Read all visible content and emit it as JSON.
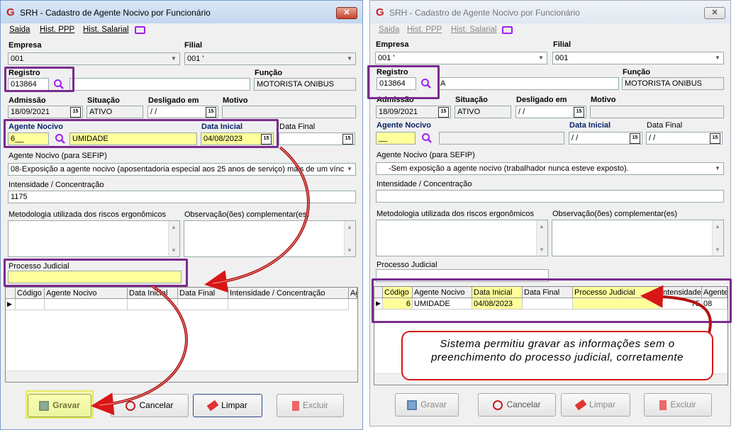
{
  "left": {
    "title": "SRH - Cadastro de Agente Nocivo por Funcionário",
    "close": "✕",
    "menu": {
      "saida": "Saida",
      "ppp": "Hist. PPP",
      "salarial": "Hist. Salarial"
    },
    "empresa": {
      "label": "Empresa",
      "value": "001"
    },
    "filial": {
      "label": "Filial",
      "value": "001 '"
    },
    "registro": {
      "label": "Registro",
      "value": "013864",
      "name": ""
    },
    "funcao": {
      "label": "Função",
      "value": "MOTORISTA ONIBUS"
    },
    "admissao": {
      "label": "Admissão",
      "value": "18/09/2021"
    },
    "situacao": {
      "label": "Situação",
      "value": "ATIVO"
    },
    "desligado": {
      "label": "Desligado em",
      "value": " / /"
    },
    "motivo": {
      "label": "Motivo",
      "value": ""
    },
    "agente": {
      "label": "Agente Nocivo",
      "code": "6__",
      "name": "UMIDADE"
    },
    "data_inicial": {
      "label": "Data Inicial",
      "value": "04/08/2023"
    },
    "data_final": {
      "label": "Data Final",
      "value": ""
    },
    "sefip": {
      "label": "Agente Nocivo (para SEFIP)",
      "value": "08-Exposição a agente nocivo (aposentadoria especial aos 25 anos de serviço) mais de um vínculo"
    },
    "intensidade": {
      "label": "Intensidade /  Concentração",
      "value": "1175"
    },
    "metodologia": {
      "label": "Metodologia utilizada dos riscos ergonômicos"
    },
    "observacao": {
      "label": "Observação(ões) complementar(es)"
    },
    "processo": {
      "label": "Processo Judicial",
      "value": ""
    },
    "grid": {
      "headers": [
        "Código",
        "Agente Nocivo",
        "Data Inicial",
        "Data Final",
        "Intensidade /  Concentração",
        "Ag"
      ]
    },
    "buttons": {
      "gravar": "Gravar",
      "cancelar": "Cancelar",
      "limpar": "Limpar",
      "excluir": "Excluir"
    }
  },
  "right": {
    "title": "SRH - Cadastro de Agente Nocivo por Funcionário",
    "close": "✕",
    "menu": {
      "saida": "Saida",
      "ppp": "Hist. PPP",
      "salarial": "Hist. Salarial"
    },
    "empresa": {
      "label": "Empresa",
      "value": "001 '"
    },
    "filial": {
      "label": "Filial",
      "value": "001"
    },
    "registro": {
      "label": "Registro",
      "value": "013864",
      "name": "A"
    },
    "funcao": {
      "label": "Função",
      "value": "MOTORISTA ONIBUS"
    },
    "admissao": {
      "label": "Admissão",
      "value": "18/09/2021"
    },
    "situacao": {
      "label": "Situação",
      "value": "ATIVO"
    },
    "desligado": {
      "label": "Desligado em",
      "value": " / /"
    },
    "motivo": {
      "label": "Motivo",
      "value": ""
    },
    "agente": {
      "label": "Agente Nocivo",
      "code": "__",
      "name": ""
    },
    "data_inicial": {
      "label": "Data Inicial",
      "value": " / /"
    },
    "data_final": {
      "label": "Data Final",
      "value": " / /"
    },
    "sefip": {
      "label": "Agente Nocivo (para SEFIP)",
      "value": "-Sem exposição a agente nocivo (trabalhador nunca esteve exposto)."
    },
    "intensidade": {
      "label": "Intensidade /  Concentração",
      "value": ""
    },
    "metodologia": {
      "label": "Metodologia utilizada dos riscos ergonômicos"
    },
    "observacao": {
      "label": "Observação(ões) complementar(es)"
    },
    "processo": {
      "label": "Processo Judicial",
      "value": ""
    },
    "grid": {
      "headers": [
        "Código",
        "Agente Nocivo",
        "Data Inicial",
        "Data Final",
        "Processo Judicial",
        "Intensidade",
        "Agente"
      ],
      "row": [
        "6",
        "UMIDADE",
        "04/08/2023",
        "",
        "",
        "75",
        "08"
      ]
    },
    "buttons": {
      "gravar": "Gravar",
      "cancelar": "Cancelar",
      "limpar": "Limpar",
      "excluir": "Excluir"
    }
  },
  "callout": {
    "line1": "Sistema permitiu gravar as informações sem o",
    "line2": "preenchimento do processo judicial, corretamente"
  },
  "colors": {
    "highlight": "#7a2b8d",
    "arrow": "#d81616",
    "yellow": "#ffff9c"
  }
}
